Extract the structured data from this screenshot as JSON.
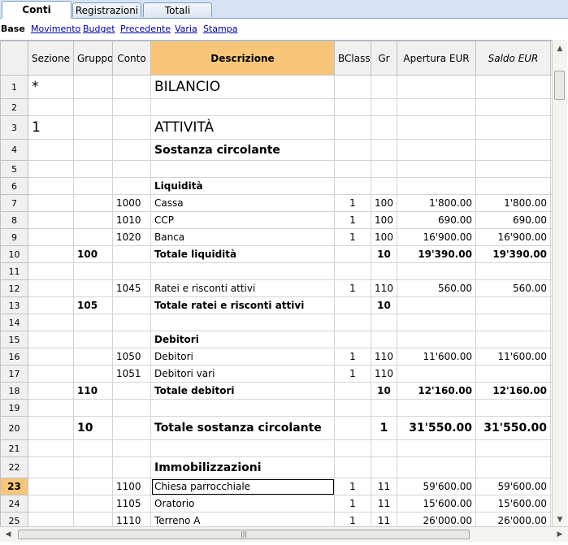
{
  "tabs": [
    {
      "label": "Conti",
      "active": true
    },
    {
      "label": "Registrazioni",
      "active": false
    },
    {
      "label": "Totali",
      "active": false
    }
  ],
  "views": [
    "Base",
    "Movimento",
    "Budget",
    "Precedente",
    "Varia",
    "Stampa"
  ],
  "active_view": "Base",
  "columns": [
    "Sezione",
    "Gruppo",
    "Conto",
    "Descrizione",
    "BClasse",
    "Gr",
    "Apertura EUR",
    "Saldo EUR"
  ],
  "rows": [
    {
      "n": "1",
      "sezione": "*",
      "gruppo": "",
      "conto": "",
      "descrizione": "BILANCIO",
      "bclasse": "",
      "gr": "",
      "apertura": "",
      "saldo": "",
      "style": "title"
    },
    {
      "n": "2",
      "sezione": "",
      "gruppo": "",
      "conto": "",
      "descrizione": "",
      "bclasse": "",
      "gr": "",
      "apertura": "",
      "saldo": "",
      "style": "normal"
    },
    {
      "n": "3",
      "sezione": "1",
      "gruppo": "",
      "conto": "",
      "descrizione": "ATTIVITÀ",
      "bclasse": "",
      "gr": "",
      "apertura": "",
      "saldo": "",
      "style": "title"
    },
    {
      "n": "4",
      "sezione": "",
      "gruppo": "",
      "conto": "",
      "descrizione": "Sostanza circolante",
      "bclasse": "",
      "gr": "",
      "apertura": "",
      "saldo": "",
      "style": "heading"
    },
    {
      "n": "5",
      "sezione": "",
      "gruppo": "",
      "conto": "",
      "descrizione": "",
      "bclasse": "",
      "gr": "",
      "apertura": "",
      "saldo": "",
      "style": "normal"
    },
    {
      "n": "6",
      "sezione": "",
      "gruppo": "",
      "conto": "",
      "descrizione": "Liquidità",
      "bclasse": "",
      "gr": "",
      "apertura": "",
      "saldo": "",
      "style": "bold"
    },
    {
      "n": "7",
      "sezione": "",
      "gruppo": "",
      "conto": "1000",
      "descrizione": "Cassa",
      "bclasse": "1",
      "gr": "100",
      "apertura": "1'800.00",
      "saldo": "1'800.00",
      "style": "normal"
    },
    {
      "n": "8",
      "sezione": "",
      "gruppo": "",
      "conto": "1010",
      "descrizione": "CCP",
      "bclasse": "1",
      "gr": "100",
      "apertura": "690.00",
      "saldo": "690.00",
      "style": "normal"
    },
    {
      "n": "9",
      "sezione": "",
      "gruppo": "",
      "conto": "1020",
      "descrizione": "Banca",
      "bclasse": "1",
      "gr": "100",
      "apertura": "16'900.00",
      "saldo": "16'900.00",
      "style": "normal"
    },
    {
      "n": "10",
      "sezione": "",
      "gruppo": "100",
      "conto": "",
      "descrizione": "Totale liquidità",
      "bclasse": "",
      "gr": "10",
      "apertura": "19'390.00",
      "saldo": "19'390.00",
      "style": "bold"
    },
    {
      "n": "11",
      "sezione": "",
      "gruppo": "",
      "conto": "",
      "descrizione": "",
      "bclasse": "",
      "gr": "",
      "apertura": "",
      "saldo": "",
      "style": "normal"
    },
    {
      "n": "12",
      "sezione": "",
      "gruppo": "",
      "conto": "1045",
      "descrizione": "Ratei e risconti attivi",
      "bclasse": "1",
      "gr": "110",
      "apertura": "560.00",
      "saldo": "560.00",
      "style": "normal"
    },
    {
      "n": "13",
      "sezione": "",
      "gruppo": "105",
      "conto": "",
      "descrizione": "Totale ratei e risconti attivi",
      "bclasse": "",
      "gr": "10",
      "apertura": "",
      "saldo": "",
      "style": "bold"
    },
    {
      "n": "14",
      "sezione": "",
      "gruppo": "",
      "conto": "",
      "descrizione": "",
      "bclasse": "",
      "gr": "",
      "apertura": "",
      "saldo": "",
      "style": "normal"
    },
    {
      "n": "15",
      "sezione": "",
      "gruppo": "",
      "conto": "",
      "descrizione": "Debitori",
      "bclasse": "",
      "gr": "",
      "apertura": "",
      "saldo": "",
      "style": "bold"
    },
    {
      "n": "16",
      "sezione": "",
      "gruppo": "",
      "conto": "1050",
      "descrizione": "Debitori",
      "bclasse": "1",
      "gr": "110",
      "apertura": "11'600.00",
      "saldo": "11'600.00",
      "style": "normal"
    },
    {
      "n": "17",
      "sezione": "",
      "gruppo": "",
      "conto": "1051",
      "descrizione": "Debitori vari",
      "bclasse": "1",
      "gr": "110",
      "apertura": "",
      "saldo": "",
      "style": "normal"
    },
    {
      "n": "18",
      "sezione": "",
      "gruppo": "110",
      "conto": "",
      "descrizione": "Totale debitori",
      "bclasse": "",
      "gr": "10",
      "apertura": "12'160.00",
      "saldo": "12'160.00",
      "style": "bold"
    },
    {
      "n": "19",
      "sezione": "",
      "gruppo": "",
      "conto": "",
      "descrizione": "",
      "bclasse": "",
      "gr": "",
      "apertura": "",
      "saldo": "",
      "style": "normal"
    },
    {
      "n": "20",
      "sezione": "",
      "gruppo": "10",
      "conto": "",
      "descrizione": "Totale sostanza circolante",
      "bclasse": "",
      "gr": "1",
      "apertura": "31'550.00",
      "saldo": "31'550.00",
      "style": "bigtotal"
    },
    {
      "n": "21",
      "sezione": "",
      "gruppo": "",
      "conto": "",
      "descrizione": "",
      "bclasse": "",
      "gr": "",
      "apertura": "",
      "saldo": "",
      "style": "normal"
    },
    {
      "n": "22",
      "sezione": "",
      "gruppo": "",
      "conto": "",
      "descrizione": "Immobilizzazioni",
      "bclasse": "",
      "gr": "",
      "apertura": "",
      "saldo": "",
      "style": "heading"
    },
    {
      "n": "23",
      "sezione": "",
      "gruppo": "",
      "conto": "1100",
      "descrizione": "Chiesa parrocchiale",
      "bclasse": "1",
      "gr": "11",
      "apertura": "59'600.00",
      "saldo": "59'600.00",
      "style": "current"
    },
    {
      "n": "24",
      "sezione": "",
      "gruppo": "",
      "conto": "1105",
      "descrizione": "Oratorio",
      "bclasse": "1",
      "gr": "11",
      "apertura": "15'600.00",
      "saldo": "15'600.00",
      "style": "normal"
    },
    {
      "n": "25",
      "sezione": "",
      "gruppo": "",
      "conto": "1110",
      "descrizione": "Terreno A",
      "bclasse": "1",
      "gr": "11",
      "apertura": "26'000.00",
      "saldo": "26'000.00",
      "style": "normal"
    }
  ],
  "icons": {
    "scroll_up": "arrow-up-icon",
    "scroll_down": "arrow-down-icon",
    "scroll_left": "arrow-left-icon",
    "scroll_right": "arrow-right-icon"
  },
  "colors": {
    "header_highlight": "#f7c67a",
    "link": "#00009c"
  }
}
